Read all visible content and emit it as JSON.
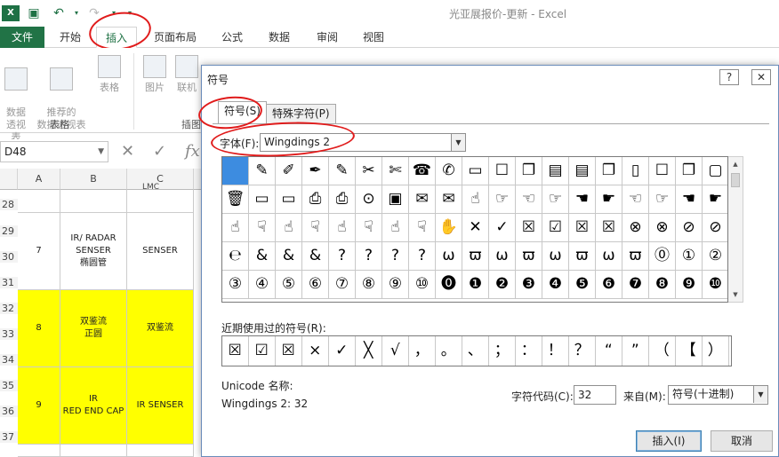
{
  "app": {
    "title": "光亚展报价-更新 - Excel",
    "logo": "X",
    "quick_access": [
      "save-icon",
      "undo-icon",
      "redo-icon"
    ]
  },
  "ribbon_tabs": [
    "文件",
    "开始",
    "插入",
    "页面布局",
    "公式",
    "数据",
    "审阅",
    "视图"
  ],
  "ribbon": {
    "buttons": [
      {
        "label": "数据\n透视表"
      },
      {
        "label": "推荐的\n数据透视表"
      },
      {
        "label": "表格"
      },
      {
        "label": "图片"
      },
      {
        "label": "联机"
      }
    ],
    "groups": [
      "表格",
      "插图"
    ]
  },
  "formula_bar": {
    "name_box": "D48",
    "cancel_icon": "✕",
    "enter_icon": "✓",
    "fx": "fx"
  },
  "grid": {
    "columns": [
      "A",
      "B",
      "C"
    ],
    "top_partial": "LMC",
    "rows": [
      "28",
      "29",
      "30",
      "31",
      "32",
      "33",
      "34",
      "35",
      "36",
      "37"
    ],
    "records": [
      {
        "a": "7",
        "b": "IR/ RADAR\nSENSER\n椭圆管",
        "c": "SENSER"
      },
      {
        "a": "8",
        "b": "双鉴流\n正圆",
        "c": "双鉴流"
      },
      {
        "a": "9",
        "b": "IR\nRED END CAP",
        "c": "IR SENSER"
      }
    ],
    "highlight_color": "#ffff00"
  },
  "dialog": {
    "title": "符号",
    "help": "?",
    "close": "✕",
    "tabs": [
      "符号(S)",
      "特殊字符(P)"
    ],
    "font_label": "字体(F):",
    "font_value": "Wingdings 2",
    "symbols": [
      [
        "",
        "✎",
        "✐",
        "✒",
        "✎",
        "✂",
        "✄",
        "☎",
        "✆",
        "▭",
        "☐",
        "❐",
        "▤",
        "▤",
        "❐",
        "▯",
        "☐",
        "❐",
        "▢"
      ],
      [
        "🗑",
        "▭",
        "▭",
        "⎙",
        "⎙",
        "⊙",
        "▣",
        "✉",
        "✉",
        "☝",
        "☞",
        "☜",
        "☞",
        "☚",
        "☛",
        "☜",
        "☞",
        "☚",
        "☛"
      ],
      [
        "☝",
        "☟",
        "☝",
        "☟",
        "☝",
        "☟",
        "☝",
        "☟",
        "✋",
        "✕",
        "✓",
        "☒",
        "☑",
        "☒",
        "☒",
        "⊗",
        "⊗",
        "⊘",
        "⊘"
      ],
      [
        "℮",
        "&",
        "&",
        "&",
        "?",
        "?",
        "?",
        "?",
        "ω",
        "ϖ",
        "ω",
        "ϖ",
        "ω",
        "ϖ",
        "ω",
        "ϖ",
        "⓪",
        "①",
        "②"
      ],
      [
        "③",
        "④",
        "⑤",
        "⑥",
        "⑦",
        "⑧",
        "⑨",
        "⑩",
        "⓿",
        "❶",
        "❷",
        "❸",
        "❹",
        "❺",
        "❻",
        "❼",
        "❽",
        "❾",
        "❿"
      ]
    ],
    "recent_label": "近期使用过的符号(R):",
    "recent": [
      "☒",
      "☑",
      "☒",
      "×",
      "✓",
      "╳",
      "√",
      "，",
      "。",
      "、",
      "；",
      "：",
      "！",
      "？",
      "“",
      "”",
      "（",
      "【",
      "）"
    ],
    "unicode_label": "Unicode 名称:",
    "unicode_value": "Wingdings 2: 32",
    "code_label": "字符代码(C):",
    "code_value": "32",
    "from_label": "来自(M):",
    "from_value": "符号(十进制)",
    "insert_button": "插入(I)",
    "cancel_button": "取消"
  },
  "colors": {
    "excel_green": "#217346",
    "selected_symbol": "#3d8ce0",
    "annotation_red": "#e01b1b"
  }
}
